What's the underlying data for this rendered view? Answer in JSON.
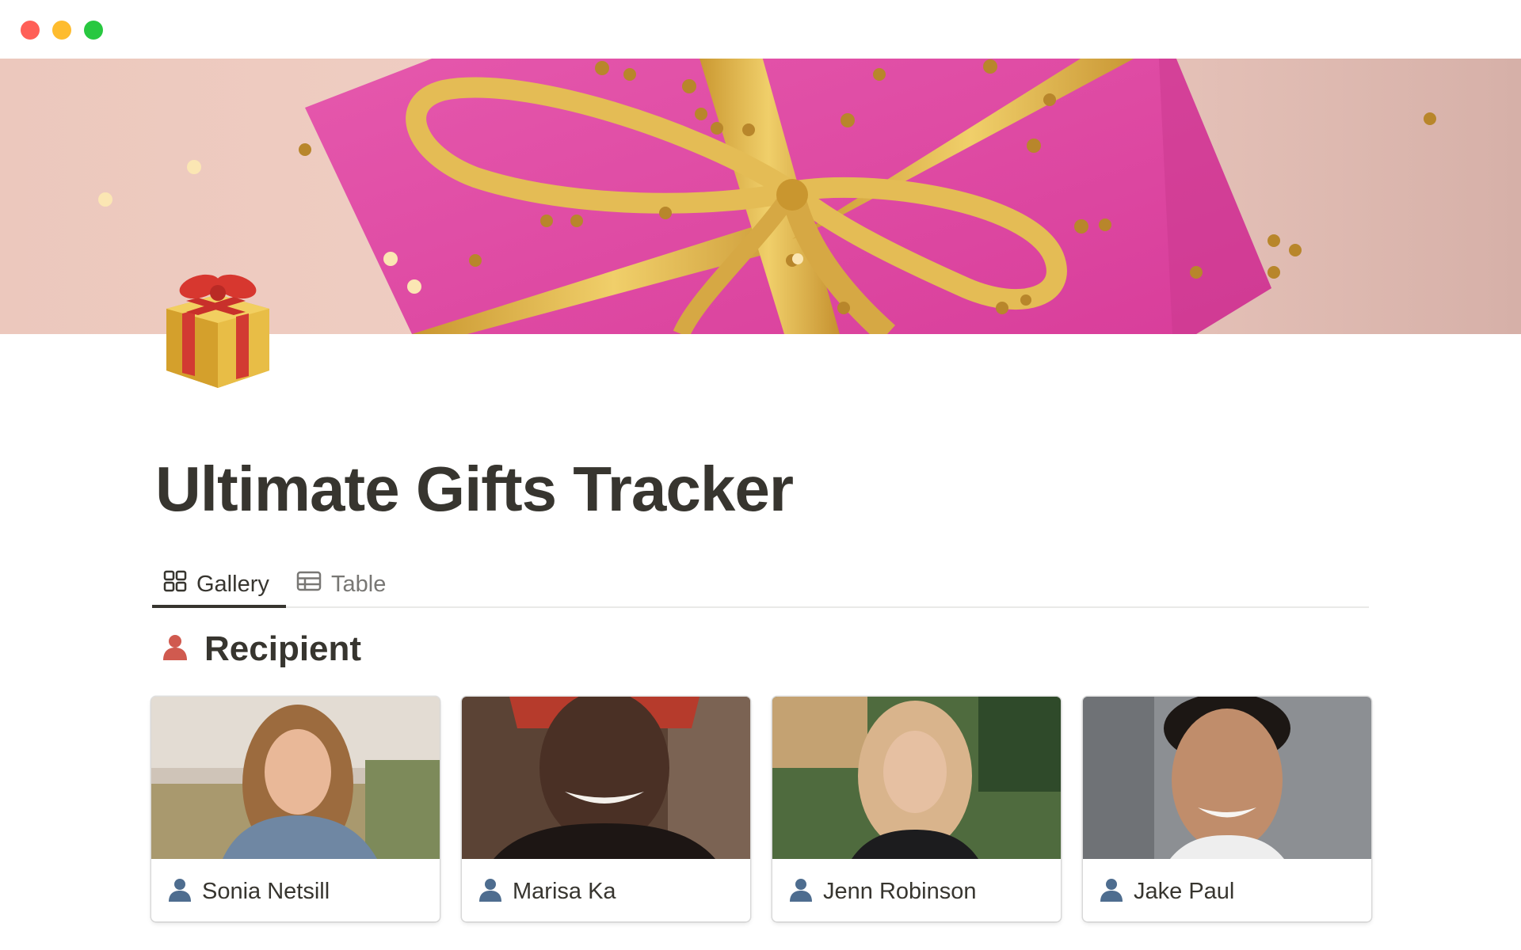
{
  "window": {
    "controls": [
      "close",
      "minimize",
      "zoom"
    ]
  },
  "page": {
    "icon": "wrapped-gift-icon",
    "title": "Ultimate Gifts Tracker"
  },
  "views": {
    "tabs": [
      {
        "label": "Gallery",
        "icon": "gallery-icon",
        "active": true
      },
      {
        "label": "Table",
        "icon": "table-icon",
        "active": false
      }
    ]
  },
  "section": {
    "icon": "person-icon",
    "title": "Recipient"
  },
  "recipients": [
    {
      "name": "Sonia Netsill",
      "icon": "person-icon"
    },
    {
      "name": "Marisa Ka",
      "icon": "person-icon"
    },
    {
      "name": "Jenn Robinson",
      "icon": "person-icon"
    },
    {
      "name": "Jake Paul",
      "icon": "person-icon"
    }
  ],
  "colors": {
    "text": "#37352f",
    "muted": "#787774",
    "gift_pink": "#e24aa6",
    "ribbon_gold": "#d9b24a",
    "person_icon_red": "#d05a4f",
    "person_icon_blue": "#4e6d8f"
  }
}
